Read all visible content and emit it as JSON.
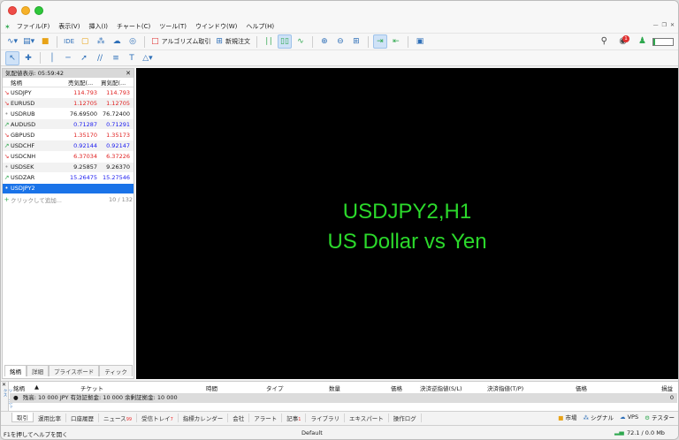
{
  "colors": {
    "up": "#1a1af0",
    "down": "#e02020",
    "chart_text": "#2bd92b",
    "selection": "#1a73e8"
  },
  "menu": [
    "ファイル(F)",
    "表示(V)",
    "挿入(I)",
    "チャート(C)",
    "ツール(T)",
    "ウインドウ(W)",
    "ヘルプ(H)"
  ],
  "toolbar": {
    "ide_label": "IDE",
    "algo_label": "アルゴリズム取引",
    "new_order_label": "新規注文",
    "notification_count": "1"
  },
  "market_watch": {
    "header": "気配値表示: 05:59:42",
    "columns": {
      "symbol": "銘柄",
      "bid": "売気配(...",
      "ask": "買気配(..."
    },
    "rows": [
      {
        "symbol": "USDJPY",
        "bid": "114.793",
        "ask": "114.793",
        "trend": "down"
      },
      {
        "symbol": "EURUSD",
        "bid": "1.12705",
        "ask": "1.12705",
        "trend": "down"
      },
      {
        "symbol": "USDRUB",
        "bid": "76.69500",
        "ask": "76.72400",
        "trend": "neutral"
      },
      {
        "symbol": "AUDUSD",
        "bid": "0.71287",
        "ask": "0.71291",
        "trend": "up"
      },
      {
        "symbol": "GBPUSD",
        "bid": "1.35170",
        "ask": "1.35173",
        "trend": "down"
      },
      {
        "symbol": "USDCHF",
        "bid": "0.92144",
        "ask": "0.92147",
        "trend": "up"
      },
      {
        "symbol": "USDCNH",
        "bid": "6.37034",
        "ask": "6.37226",
        "trend": "down"
      },
      {
        "symbol": "USDSEK",
        "bid": "9.25857",
        "ask": "9.26370",
        "trend": "neutral"
      },
      {
        "symbol": "USDZAR",
        "bid": "15.26475",
        "ask": "15.27546",
        "trend": "up"
      },
      {
        "symbol": "USDJPY2",
        "bid": "",
        "ask": "",
        "trend": "neutral",
        "selected": true
      }
    ],
    "add_label": "クリックして追加...",
    "count": "10 / 132",
    "tabs": [
      "銘柄",
      "詳細",
      "プライスボード",
      "ティック"
    ]
  },
  "chart": {
    "line1": "USDJPY2,H1",
    "line2": "US Dollar vs Yen"
  },
  "trade_table": {
    "columns": [
      "銘柄",
      "チケット",
      "時間",
      "タイプ",
      "数量",
      "価格",
      "決済逆指値(S/L)",
      "決済指値(T/P)",
      "価格",
      "損益"
    ],
    "balance_line": "残高: 10 000 JPY  有効証拠金: 10 000  余剰証拠金: 10 000",
    "balance_value": "0",
    "side_label": "ツールボックス"
  },
  "bottom_tabs": [
    {
      "label": "取引",
      "sub": ""
    },
    {
      "label": "運用比率",
      "sub": ""
    },
    {
      "label": "口座履歴",
      "sub": ""
    },
    {
      "label": "ニュース",
      "sub": "99"
    },
    {
      "label": "受信トレイ",
      "sub": "7"
    },
    {
      "label": "指標カレンダー",
      "sub": ""
    },
    {
      "label": "会社",
      "sub": ""
    },
    {
      "label": "アラート",
      "sub": ""
    },
    {
      "label": "記事",
      "sub": "1"
    },
    {
      "label": "ライブラリ",
      "sub": ""
    },
    {
      "label": "エキスパート",
      "sub": ""
    },
    {
      "label": "操作ログ",
      "sub": ""
    }
  ],
  "bottom_tools": {
    "market": "市場",
    "signal": "シグナル",
    "vps": "VPS",
    "tester": "テスター"
  },
  "status": {
    "help": "F1を押してヘルプを開く",
    "profile": "Default",
    "connection": "72.1 / 0.0 Mb"
  }
}
